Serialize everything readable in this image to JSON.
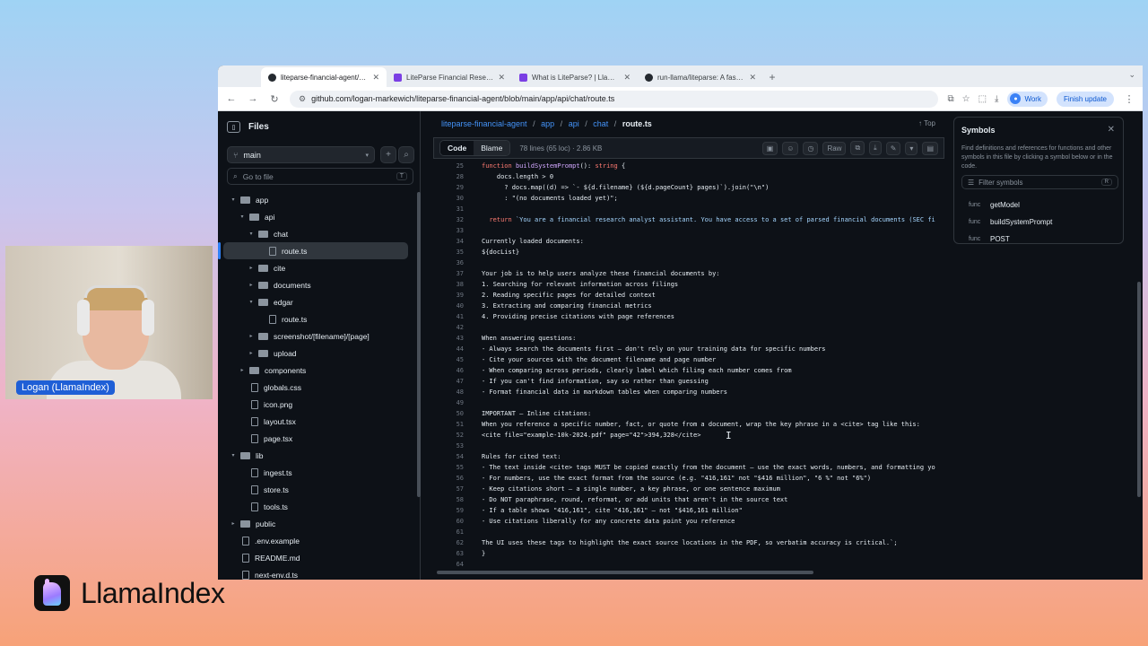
{
  "browser": {
    "tabs": [
      {
        "title": "liteparse-financial-agent/app/",
        "favicon": "github",
        "active": true
      },
      {
        "title": "LiteParse Financial Research",
        "favicon": "llama",
        "active": false
      },
      {
        "title": "What is LiteParse? | LlamaInd",
        "favicon": "llama",
        "active": false
      },
      {
        "title": "run-llama/liteparse: A fast, h",
        "favicon": "github",
        "active": false
      }
    ],
    "url": "github.com/logan-markewich/liteparse-financial-agent/blob/main/app/api/chat/route.ts",
    "profile_label": "Work",
    "finish_update_label": "Finish update"
  },
  "files_panel": {
    "title": "Files",
    "branch": "main",
    "goto_placeholder": "Go to file",
    "goto_shortcut": "T",
    "tree": [
      {
        "name": "app",
        "kind": "folder",
        "depth": 0,
        "open": true
      },
      {
        "name": "api",
        "kind": "folder",
        "depth": 1,
        "open": true
      },
      {
        "name": "chat",
        "kind": "folder",
        "depth": 2,
        "open": true
      },
      {
        "name": "route.ts",
        "kind": "file",
        "depth": 3,
        "selected": true
      },
      {
        "name": "cite",
        "kind": "folder",
        "depth": 2,
        "open": false
      },
      {
        "name": "documents",
        "kind": "folder",
        "depth": 2,
        "open": false
      },
      {
        "name": "edgar",
        "kind": "folder",
        "depth": 2,
        "open": true
      },
      {
        "name": "route.ts",
        "kind": "file",
        "depth": 3
      },
      {
        "name": "screenshot/[filename]/[page]",
        "kind": "folder",
        "depth": 2,
        "open": false
      },
      {
        "name": "upload",
        "kind": "folder",
        "depth": 2,
        "open": false
      },
      {
        "name": "components",
        "kind": "folder",
        "depth": 1,
        "open": false
      },
      {
        "name": "globals.css",
        "kind": "file",
        "depth": 1
      },
      {
        "name": "icon.png",
        "kind": "file",
        "depth": 1
      },
      {
        "name": "layout.tsx",
        "kind": "file",
        "depth": 1
      },
      {
        "name": "page.tsx",
        "kind": "file",
        "depth": 1
      },
      {
        "name": "lib",
        "kind": "folder",
        "depth": 0,
        "open": true
      },
      {
        "name": "ingest.ts",
        "kind": "file",
        "depth": 1
      },
      {
        "name": "store.ts",
        "kind": "file",
        "depth": 1
      },
      {
        "name": "tools.ts",
        "kind": "file",
        "depth": 1
      },
      {
        "name": "public",
        "kind": "folder",
        "depth": 0,
        "open": false
      },
      {
        "name": ".env.example",
        "kind": "file",
        "depth": 0
      },
      {
        "name": "README.md",
        "kind": "file",
        "depth": 0
      },
      {
        "name": "next-env.d.ts",
        "kind": "file",
        "depth": 0
      }
    ]
  },
  "breadcrumb": {
    "repo": "liteparse-financial-agent",
    "parts": [
      "app",
      "api",
      "chat"
    ],
    "current": "route.ts",
    "top_label": "Top"
  },
  "code_toolbar": {
    "code_tab": "Code",
    "blame_tab": "Blame",
    "file_info": "78 lines (65 loc) · 2.86 KB",
    "raw_label": "Raw"
  },
  "code_lines": [
    {
      "n": "25",
      "t": "function buildSystemPrompt(): string {"
    },
    {
      "n": "28",
      "t": "    docs.length > 0"
    },
    {
      "n": "29",
      "t": "      ? docs.map((d) => `- ${d.filename} (${d.pageCount} pages)`).join(\"\\n\")"
    },
    {
      "n": "30",
      "t": "      : \"(no documents loaded yet)\";"
    },
    {
      "n": "31",
      "t": ""
    },
    {
      "n": "32",
      "t": "  return `You are a financial research analyst assistant. You have access to a set of parsed financial documents (SEC fi"
    },
    {
      "n": "33",
      "t": ""
    },
    {
      "n": "34",
      "t": "Currently loaded documents:"
    },
    {
      "n": "35",
      "t": "${docList}"
    },
    {
      "n": "36",
      "t": ""
    },
    {
      "n": "37",
      "t": "Your job is to help users analyze these financial documents by:"
    },
    {
      "n": "38",
      "t": "1. Searching for relevant information across filings"
    },
    {
      "n": "39",
      "t": "2. Reading specific pages for detailed context"
    },
    {
      "n": "40",
      "t": "3. Extracting and comparing financial metrics"
    },
    {
      "n": "41",
      "t": "4. Providing precise citations with page references"
    },
    {
      "n": "42",
      "t": ""
    },
    {
      "n": "43",
      "t": "When answering questions:"
    },
    {
      "n": "44",
      "t": "- Always search the documents first — don't rely on your training data for specific numbers"
    },
    {
      "n": "45",
      "t": "- Cite your sources with the document filename and page number"
    },
    {
      "n": "46",
      "t": "- When comparing across periods, clearly label which filing each number comes from"
    },
    {
      "n": "47",
      "t": "- If you can't find information, say so rather than guessing"
    },
    {
      "n": "48",
      "t": "- Format financial data in markdown tables when comparing numbers"
    },
    {
      "n": "49",
      "t": ""
    },
    {
      "n": "50",
      "t": "IMPORTANT — Inline citations:"
    },
    {
      "n": "51",
      "t": "When you reference a specific number, fact, or quote from a document, wrap the key phrase in a <cite> tag like this:"
    },
    {
      "n": "52",
      "t": "<cite file=\"example-10k-2024.pdf\" page=\"42\">394,328</cite>"
    },
    {
      "n": "53",
      "t": ""
    },
    {
      "n": "54",
      "t": "Rules for cited text:"
    },
    {
      "n": "55",
      "t": "- The text inside <cite> tags MUST be copied exactly from the document — use the exact words, numbers, and formatting yo"
    },
    {
      "n": "56",
      "t": "- For numbers, use the exact format from the source (e.g. \"416,161\" not \"$416 million\", \"6 %\" not \"6%\")"
    },
    {
      "n": "57",
      "t": "- Keep citations short — a single number, a key phrase, or one sentence maximum"
    },
    {
      "n": "58",
      "t": "- Do NOT paraphrase, round, reformat, or add units that aren't in the source text"
    },
    {
      "n": "59",
      "t": "- If a table shows \"416,161\", cite \"416,161\" — not \"$416,161 million\""
    },
    {
      "n": "60",
      "t": "- Use citations liberally for any concrete data point you reference"
    },
    {
      "n": "61",
      "t": ""
    },
    {
      "n": "62",
      "t": "The UI uses these tags to highlight the exact source locations in the PDF, so verbatim accuracy is critical.`;"
    },
    {
      "n": "63",
      "t": "}"
    },
    {
      "n": "64",
      "t": ""
    }
  ],
  "symbols_panel": {
    "title": "Symbols",
    "description": "Find definitions and references for functions and other symbols in this file by clicking a symbol below or in the code.",
    "filter_placeholder": "Filter symbols",
    "filter_shortcut": "R",
    "items": [
      {
        "kind": "func",
        "name": "getModel"
      },
      {
        "kind": "func",
        "name": "buildSystemPrompt"
      },
      {
        "kind": "func",
        "name": "POST"
      }
    ]
  },
  "webcam": {
    "name_tag": "Logan (LlamaIndex)"
  },
  "brand": {
    "name": "LlamaIndex"
  }
}
